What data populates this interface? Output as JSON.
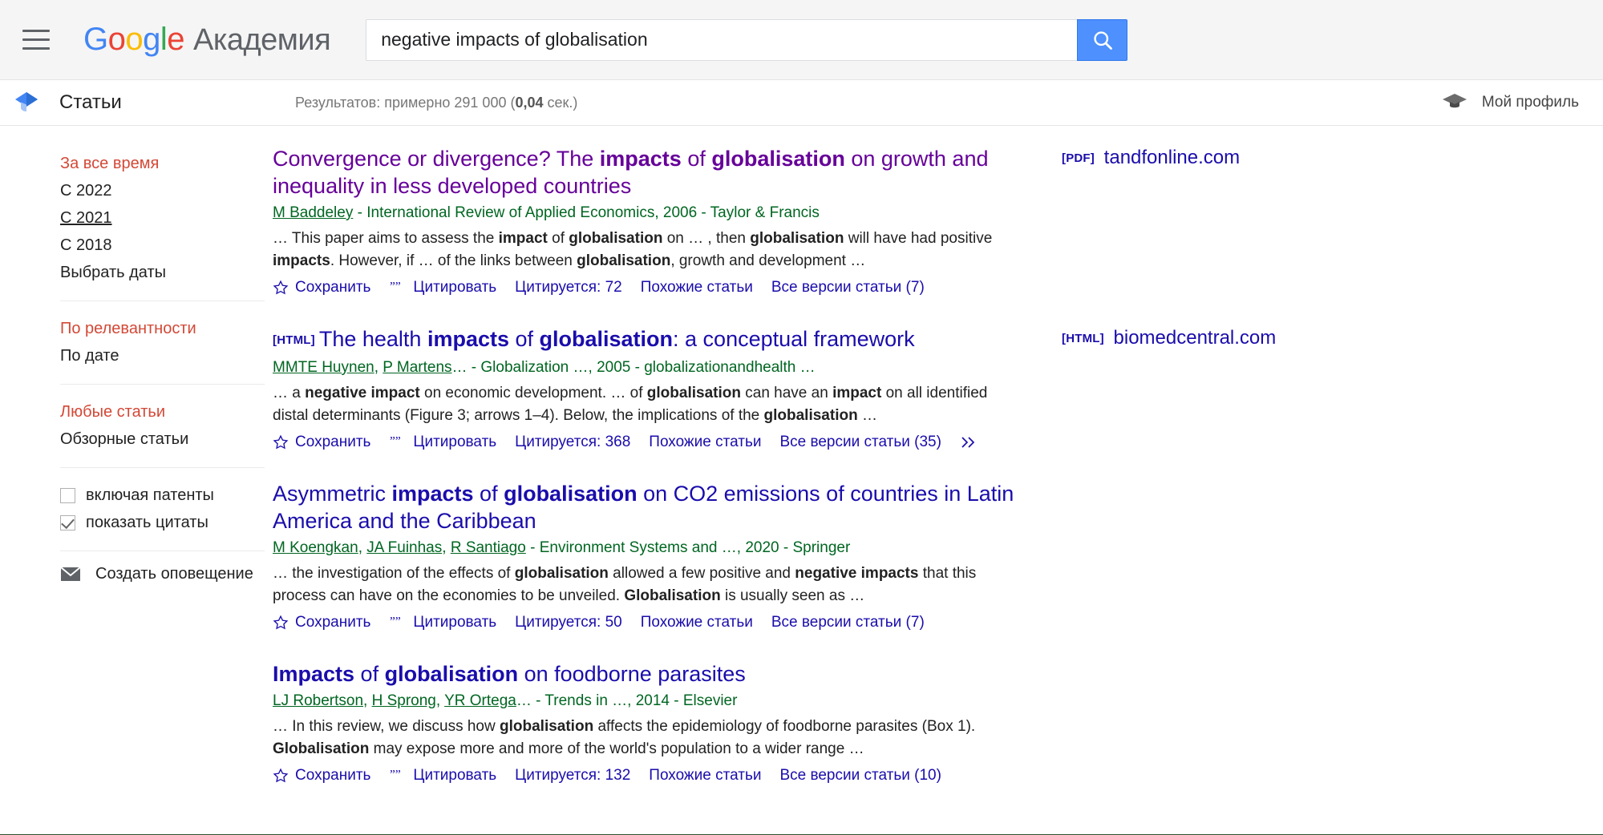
{
  "header": {
    "menu_icon": "hamburger-menu-icon",
    "logo_text": "Google",
    "logo_subtitle": "Академия",
    "search": {
      "value": "negative impacts of globalisation",
      "placeholder": "",
      "button_icon": "search-icon"
    }
  },
  "subheader": {
    "scholar_icon": "scholar-cap-icon",
    "articles_label": "Статьи",
    "results_prefix": "Результатов: примерно 291 000 (",
    "results_time": "0,04",
    "results_suffix": " сек.)",
    "profile_icon": "graduation-cap-icon",
    "profile_label": "Мой профиль"
  },
  "sidebar": {
    "date_group": [
      {
        "label": "За все время",
        "state": "active"
      },
      {
        "label": "С 2022",
        "state": "normal"
      },
      {
        "label": "С 2021",
        "state": "hovered"
      },
      {
        "label": "С 2018",
        "state": "normal"
      },
      {
        "label": "Выбрать даты",
        "state": "normal"
      }
    ],
    "sort_group": [
      {
        "label": "По релевантности",
        "state": "active"
      },
      {
        "label": "По дате",
        "state": "normal"
      }
    ],
    "type_group": [
      {
        "label": "Любые статьи",
        "state": "active"
      },
      {
        "label": "Обзорные статьи",
        "state": "normal"
      }
    ],
    "checkboxes": [
      {
        "label": "включая патенты",
        "checked": false
      },
      {
        "label": "показать цитаты",
        "checked": true
      }
    ],
    "alert": {
      "icon": "envelope-icon",
      "label": "Создать оповещение"
    }
  },
  "results": [
    {
      "tag": "",
      "title_parts": [
        {
          "t": "Convergence or divergence? The ",
          "b": false
        },
        {
          "t": "impacts",
          "b": true
        },
        {
          "t": " of ",
          "b": false
        },
        {
          "t": "globalisation",
          "b": true
        },
        {
          "t": " on growth and inequality in less developed countries",
          "b": false
        }
      ],
      "visited": true,
      "authors": "M Baddeley",
      "meta_rest": " - International Review of Applied Economics, 2006 - Taylor & Francis",
      "snippet_parts": [
        {
          "t": "… This paper aims to assess the ",
          "b": false
        },
        {
          "t": "impact",
          "b": true
        },
        {
          "t": " of ",
          "b": false
        },
        {
          "t": "globalisation",
          "b": true
        },
        {
          "t": " on … , then ",
          "b": false
        },
        {
          "t": "globalisation",
          "b": true
        },
        {
          "t": " will have had positive ",
          "b": false
        },
        {
          "t": "impacts",
          "b": true
        },
        {
          "t": ". However, if … of the links between ",
          "b": false
        },
        {
          "t": "globalisation",
          "b": true
        },
        {
          "t": ", growth and development …",
          "b": false
        }
      ],
      "links": {
        "save": "Сохранить",
        "cite": "Цитировать",
        "cited_by": "Цитируется: 72",
        "related": "Похожие статьи",
        "versions": "Все версии статьи (7)",
        "more": false
      },
      "right": {
        "tag": "[PDF]",
        "domain": "tandfonline.com"
      }
    },
    {
      "tag": "[HTML]",
      "title_parts": [
        {
          "t": "The health ",
          "b": false
        },
        {
          "t": "impacts",
          "b": true
        },
        {
          "t": " of ",
          "b": false
        },
        {
          "t": "globalisation",
          "b": true
        },
        {
          "t": ": a conceptual framework",
          "b": false
        }
      ],
      "visited": false,
      "authors": "MMTE Huynen, P Martens",
      "meta_rest": "… - Globalization …, 2005 - globalizationandhealth …",
      "snippet_parts": [
        {
          "t": "… a ",
          "b": false
        },
        {
          "t": "negative impact",
          "b": true
        },
        {
          "t": " on economic development. … of ",
          "b": false
        },
        {
          "t": "globalisation",
          "b": true
        },
        {
          "t": " can have an ",
          "b": false
        },
        {
          "t": "impact",
          "b": true
        },
        {
          "t": " on all identified distal determinants (Figure 3; arrows 1–4). Below, the implications of the ",
          "b": false
        },
        {
          "t": "globalisation",
          "b": true
        },
        {
          "t": " …",
          "b": false
        }
      ],
      "links": {
        "save": "Сохранить",
        "cite": "Цитировать",
        "cited_by": "Цитируется: 368",
        "related": "Похожие статьи",
        "versions": "Все версии статьи (35)",
        "more": true
      },
      "right": {
        "tag": "[HTML]",
        "domain": "biomedcentral.com"
      }
    },
    {
      "tag": "",
      "title_parts": [
        {
          "t": "Asymmetric ",
          "b": false
        },
        {
          "t": "impacts",
          "b": true
        },
        {
          "t": " of ",
          "b": false
        },
        {
          "t": "globalisation",
          "b": true
        },
        {
          "t": " on CO2 emissions of countries in Latin America and the Caribbean",
          "b": false
        }
      ],
      "visited": false,
      "authors": "M Koengkan, JA Fuinhas, R Santiago",
      "meta_rest": " - Environment Systems and …, 2020 - Springer",
      "snippet_parts": [
        {
          "t": "… the investigation of the effects of ",
          "b": false
        },
        {
          "t": "globalisation",
          "b": true
        },
        {
          "t": " allowed a few positive and ",
          "b": false
        },
        {
          "t": "negative impacts",
          "b": true
        },
        {
          "t": " that this process can have on the economies to be unveiled. ",
          "b": false
        },
        {
          "t": "Globalisation",
          "b": true
        },
        {
          "t": " is usually seen as …",
          "b": false
        }
      ],
      "links": {
        "save": "Сохранить",
        "cite": "Цитировать",
        "cited_by": "Цитируется: 50",
        "related": "Похожие статьи",
        "versions": "Все версии статьи (7)",
        "more": false
      },
      "right": {
        "tag": "",
        "domain": ""
      }
    },
    {
      "tag": "",
      "title_parts": [
        {
          "t": "Impacts",
          "b": true
        },
        {
          "t": " of ",
          "b": false
        },
        {
          "t": "globalisation",
          "b": true
        },
        {
          "t": " on foodborne parasites",
          "b": false
        }
      ],
      "visited": false,
      "authors": "LJ Robertson, H Sprong, YR Ortega",
      "meta_rest": "… - Trends in …, 2014 - Elsevier",
      "snippet_parts": [
        {
          "t": "… In this review, we discuss how ",
          "b": false
        },
        {
          "t": "globalisation",
          "b": true
        },
        {
          "t": " affects the epidemiology of foodborne parasites (Box 1). ",
          "b": false
        },
        {
          "t": "Globalisation",
          "b": true
        },
        {
          "t": " may expose more and more of the world's population to a wider range …",
          "b": false
        }
      ],
      "links": {
        "save": "Сохранить",
        "cite": "Цитировать",
        "cited_by": "Цитируется: 132",
        "related": "Похожие статьи",
        "versions": "Все версии статьи (10)",
        "more": false
      },
      "right": {
        "tag": "",
        "domain": ""
      }
    }
  ],
  "colors": {
    "link": "#1a0dab",
    "visited_link": "#660099",
    "green_meta": "#006621",
    "accent_red": "#d34836",
    "search_button": "#4d90fe"
  }
}
